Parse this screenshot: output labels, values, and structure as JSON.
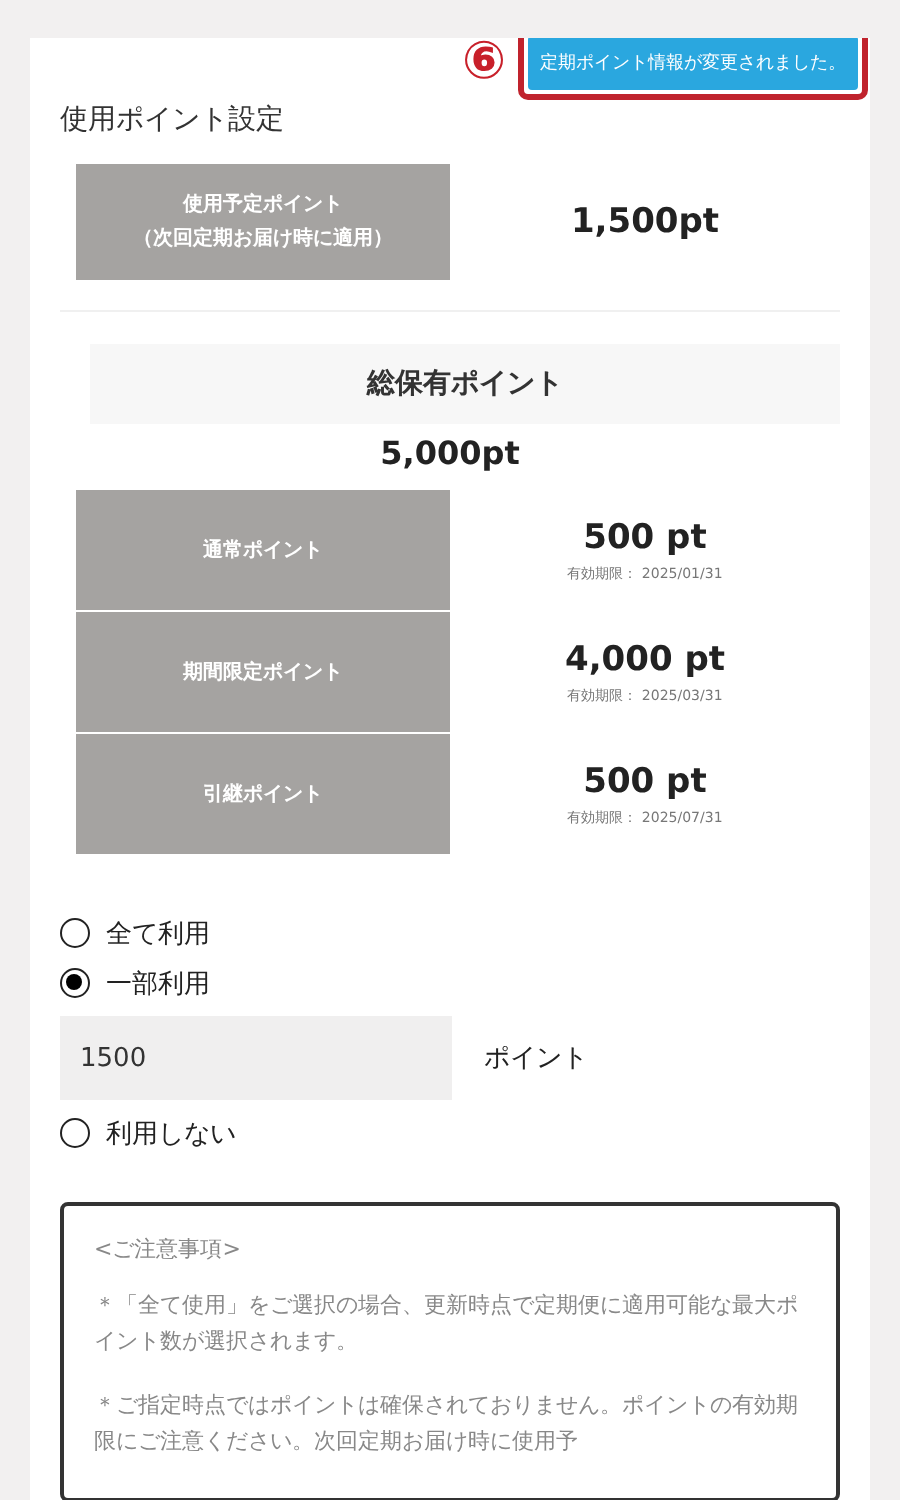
{
  "callout": {
    "number": "⑥"
  },
  "toast": {
    "text": "定期ポイント情報が変更されました。"
  },
  "section_title": "使用ポイント設定",
  "planned": {
    "label_lines": [
      "使用予定ポイント",
      "（次回定期お届け時に適用）"
    ],
    "value": "1,500pt"
  },
  "total": {
    "label": "総保有ポイント",
    "value": "5,000pt"
  },
  "breakdown": [
    {
      "label": "通常ポイント",
      "value": "500 pt",
      "expiry": "有効期限： 2025/01/31"
    },
    {
      "label": "期間限定ポイント",
      "value": "4,000 pt",
      "expiry": "有効期限： 2025/03/31"
    },
    {
      "label": "引継ポイント",
      "value": "500 pt",
      "expiry": "有効期限： 2025/07/31"
    }
  ],
  "options": [
    {
      "label": "全て利用",
      "selected": false
    },
    {
      "label": "一部利用",
      "selected": true,
      "amount": {
        "value": "1500",
        "unit": "ポイント"
      }
    },
    {
      "label": "利用しない",
      "selected": false
    }
  ],
  "notice": {
    "heading": "<ご注意事項>",
    "paragraphs": [
      "＊「全て使用」をご選択の場合、更新時点で定期便に適用可能な最大ポイント数が選択されます。",
      "＊ご指定時点ではポイントは確保されておりません。ポイントの有効期限にご注意ください。次回定期お届け時に使用予"
    ]
  }
}
